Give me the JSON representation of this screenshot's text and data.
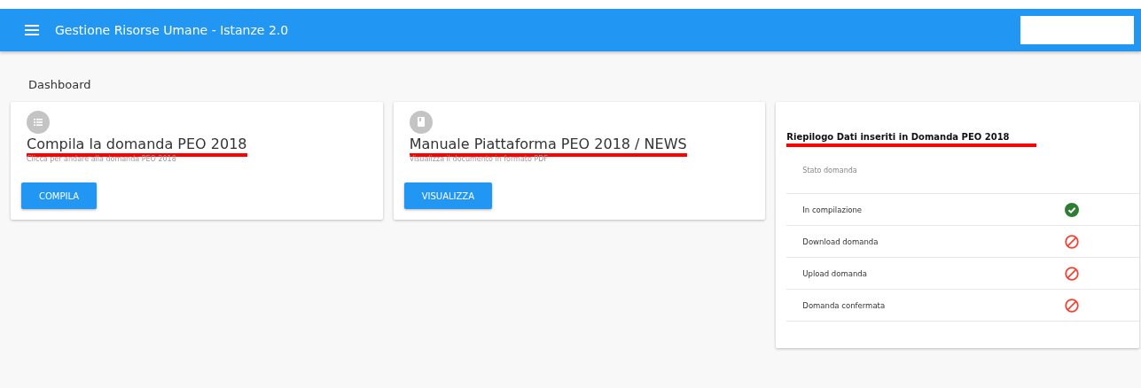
{
  "app_bar": {
    "title": "Gestione Risorse Umane - Istanze 2.0"
  },
  "page_title": "Dashboard",
  "cards": [
    {
      "kind": "list",
      "title": "Compila la domanda PEO 2018",
      "underlined": true,
      "subtitle": "Clicca per andare alla domanda PEO 2018",
      "button": "COMPILA"
    },
    {
      "kind": "book",
      "title": "Manuale Piattaforma PEO 2018 / NEWS",
      "underlined": true,
      "subtitle": "Visualizza il documento in formato PDF",
      "button": "VISUALIZZA"
    }
  ],
  "summary": {
    "title": "Riepilogo Dati inseriti in Domanda PEO 2018",
    "underlined": true,
    "header": "Stato domanda",
    "rows": [
      {
        "label": "In compilazione",
        "kind": "done"
      },
      {
        "label": "Download domanda",
        "kind": "blocked"
      },
      {
        "label": "Upload domanda",
        "kind": "blocked"
      },
      {
        "label": "Domanda confermata",
        "kind": "blocked"
      }
    ]
  }
}
